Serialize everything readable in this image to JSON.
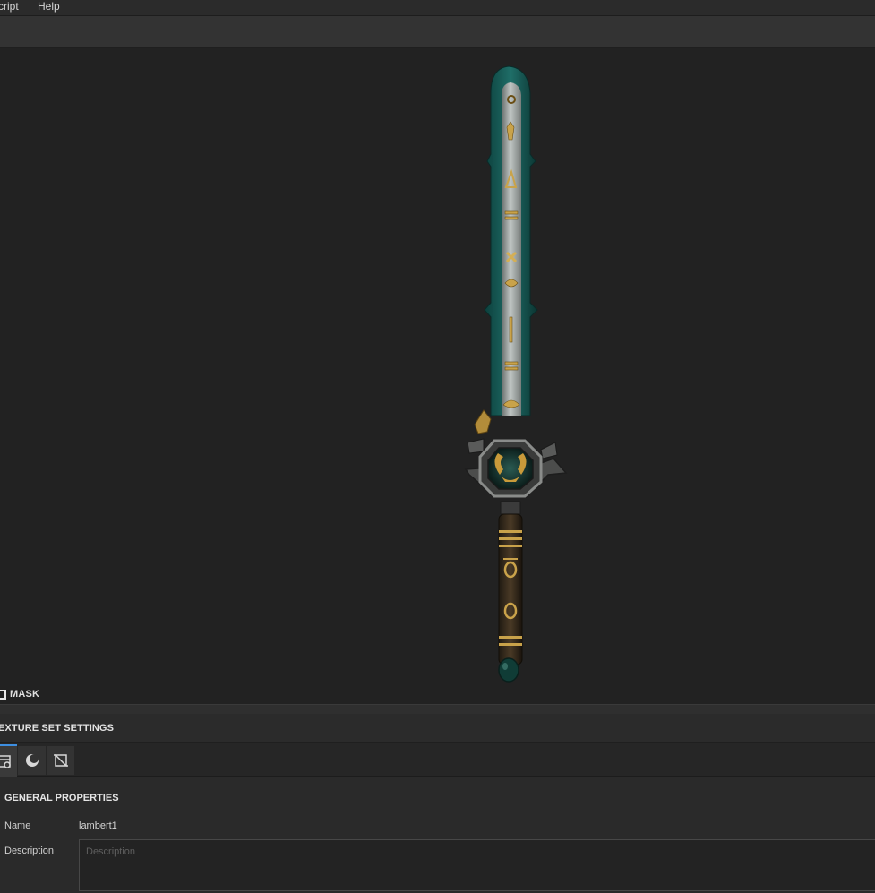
{
  "menubar": {
    "items": [
      {
        "label": "cript"
      },
      {
        "label": "Help"
      }
    ]
  },
  "viewport": {
    "model": "sword",
    "background": "#222222"
  },
  "mask": {
    "label": "MASK"
  },
  "panel": {
    "title": "EXTURE SET SETTINGS",
    "tabs": [
      {
        "icon": "texture-set-settings-icon",
        "active": true
      },
      {
        "icon": "material-sphere-icon",
        "active": false
      },
      {
        "icon": "uv-crop-icon",
        "active": false
      }
    ]
  },
  "general": {
    "title": "GENERAL PROPERTIES",
    "name_label": "Name",
    "name_value": "lambert1",
    "description_label": "Description",
    "description_placeholder": "Description"
  },
  "colors": {
    "accent": "#3d8ee0",
    "panel_bg": "#2a2a2a",
    "viewport_bg": "#222222"
  }
}
